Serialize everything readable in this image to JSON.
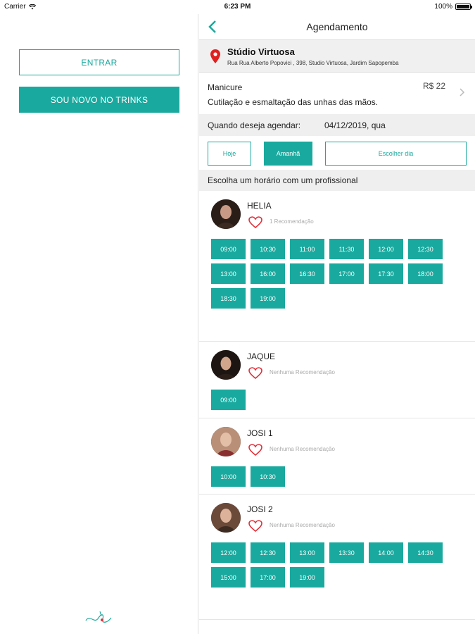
{
  "statusbar": {
    "carrier": "Carrier",
    "time": "6:23 PM",
    "battery": "100%"
  },
  "left": {
    "login_label": "ENTRAR",
    "signup_label": "SOU NOVO NO TRINKS"
  },
  "header": {
    "title": "Agendamento"
  },
  "studio": {
    "name": "Stúdio Virtuosa",
    "address": "Rua Rua Alberto Popovici , 398, Studio Virtuosa, Jardim Sapopemba"
  },
  "service": {
    "name": "Manicure",
    "price": "R$ 22",
    "description": "Cutilação e esmaltação das unhas das mãos."
  },
  "schedule": {
    "when_label": "Quando deseja agendar:",
    "date": "04/12/2019, qua"
  },
  "day_buttons": {
    "today": "Hoje",
    "tomorrow": "Amanhã",
    "choose": "Escolher dia"
  },
  "section": {
    "choose_slot": "Escolha um horário com um profissional"
  },
  "colors": {
    "accent": "#1aa99e",
    "heart": "#e0303a",
    "pin": "#e02020"
  },
  "professionals": [
    {
      "name": "HELIA",
      "recommendation": "1 Recomendação",
      "slots": [
        "09:00",
        "10:30",
        "11:00",
        "11:30",
        "12:00",
        "12:30",
        "13:00",
        "16:00",
        "16:30",
        "17:00",
        "17:30",
        "18:00",
        "18:30",
        "19:00"
      ]
    },
    {
      "name": "JAQUE",
      "recommendation": "Nenhuma Recomendação",
      "slots": [
        "09:00"
      ]
    },
    {
      "name": "JOSI 1",
      "recommendation": "Nenhuma Recomendação",
      "slots": [
        "10:00",
        "10:30"
      ]
    },
    {
      "name": "JOSI 2",
      "recommendation": "Nenhuma Recomendação",
      "slots": [
        "12:00",
        "12:30",
        "13:00",
        "13:30",
        "14:00",
        "14:30",
        "15:00",
        "17:00",
        "19:00"
      ]
    }
  ]
}
